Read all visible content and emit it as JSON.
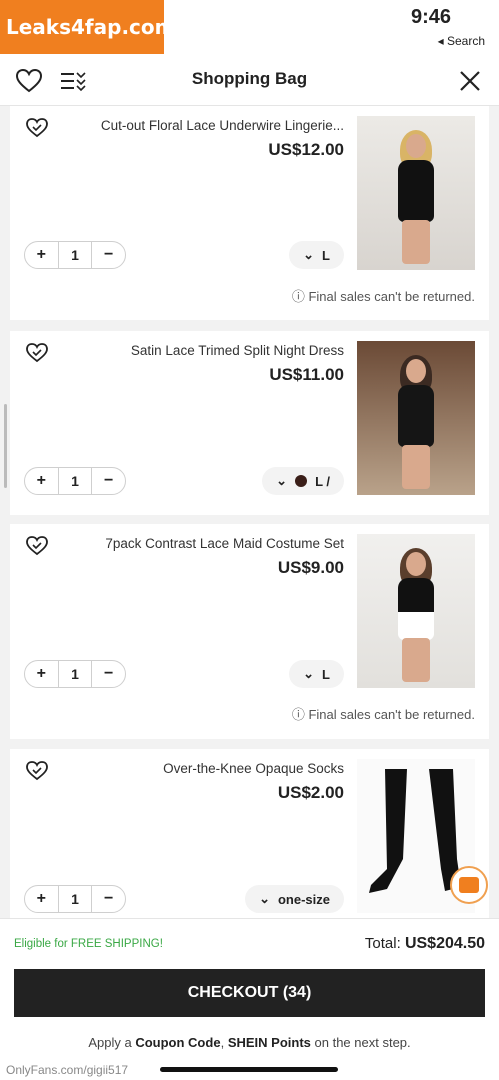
{
  "watermark": "Leaks4fap.com",
  "status": {
    "time": "9:46",
    "back": "◂ Search"
  },
  "header": {
    "title": "Shopping Bag"
  },
  "items": [
    {
      "name": "Cut-out Floral Lace Underwire Lingerie...",
      "price": "US$12.00",
      "size": "L",
      "qty": "1",
      "notice": "Final sales can't be returned."
    },
    {
      "name": "Satin Lace Trimed Split Night Dress",
      "price": "US$11.00",
      "size": "L /",
      "qty": "1",
      "color": "#3a1e18"
    },
    {
      "name": "7pack Contrast Lace Maid Costume Set",
      "price": "US$9.00",
      "size": "L",
      "qty": "1",
      "notice": "Final sales can't be returned."
    },
    {
      "name": "Over-the-Knee Opaque Socks",
      "price": "US$2.00",
      "size": "one-size",
      "qty": "1"
    }
  ],
  "stepper": {
    "minus": "−",
    "plus": "+"
  },
  "footer": {
    "total_label": "Total:",
    "total_value": "US$204.50",
    "free_shipping": "Eligible for FREE SHIPPING!",
    "checkout": "CHECKOUT (34)",
    "apply_prefix": "Apply a",
    "apply_coupon": "Coupon Code",
    "apply_mid": ",",
    "apply_points": "SHEIN Points",
    "apply_suffix": "on the next step.",
    "credit": "OnlyFans.com/gigii517"
  },
  "colors": {
    "accent": "#222222",
    "free_shipping": "#3aa845",
    "watermark": "#f07f1f"
  }
}
